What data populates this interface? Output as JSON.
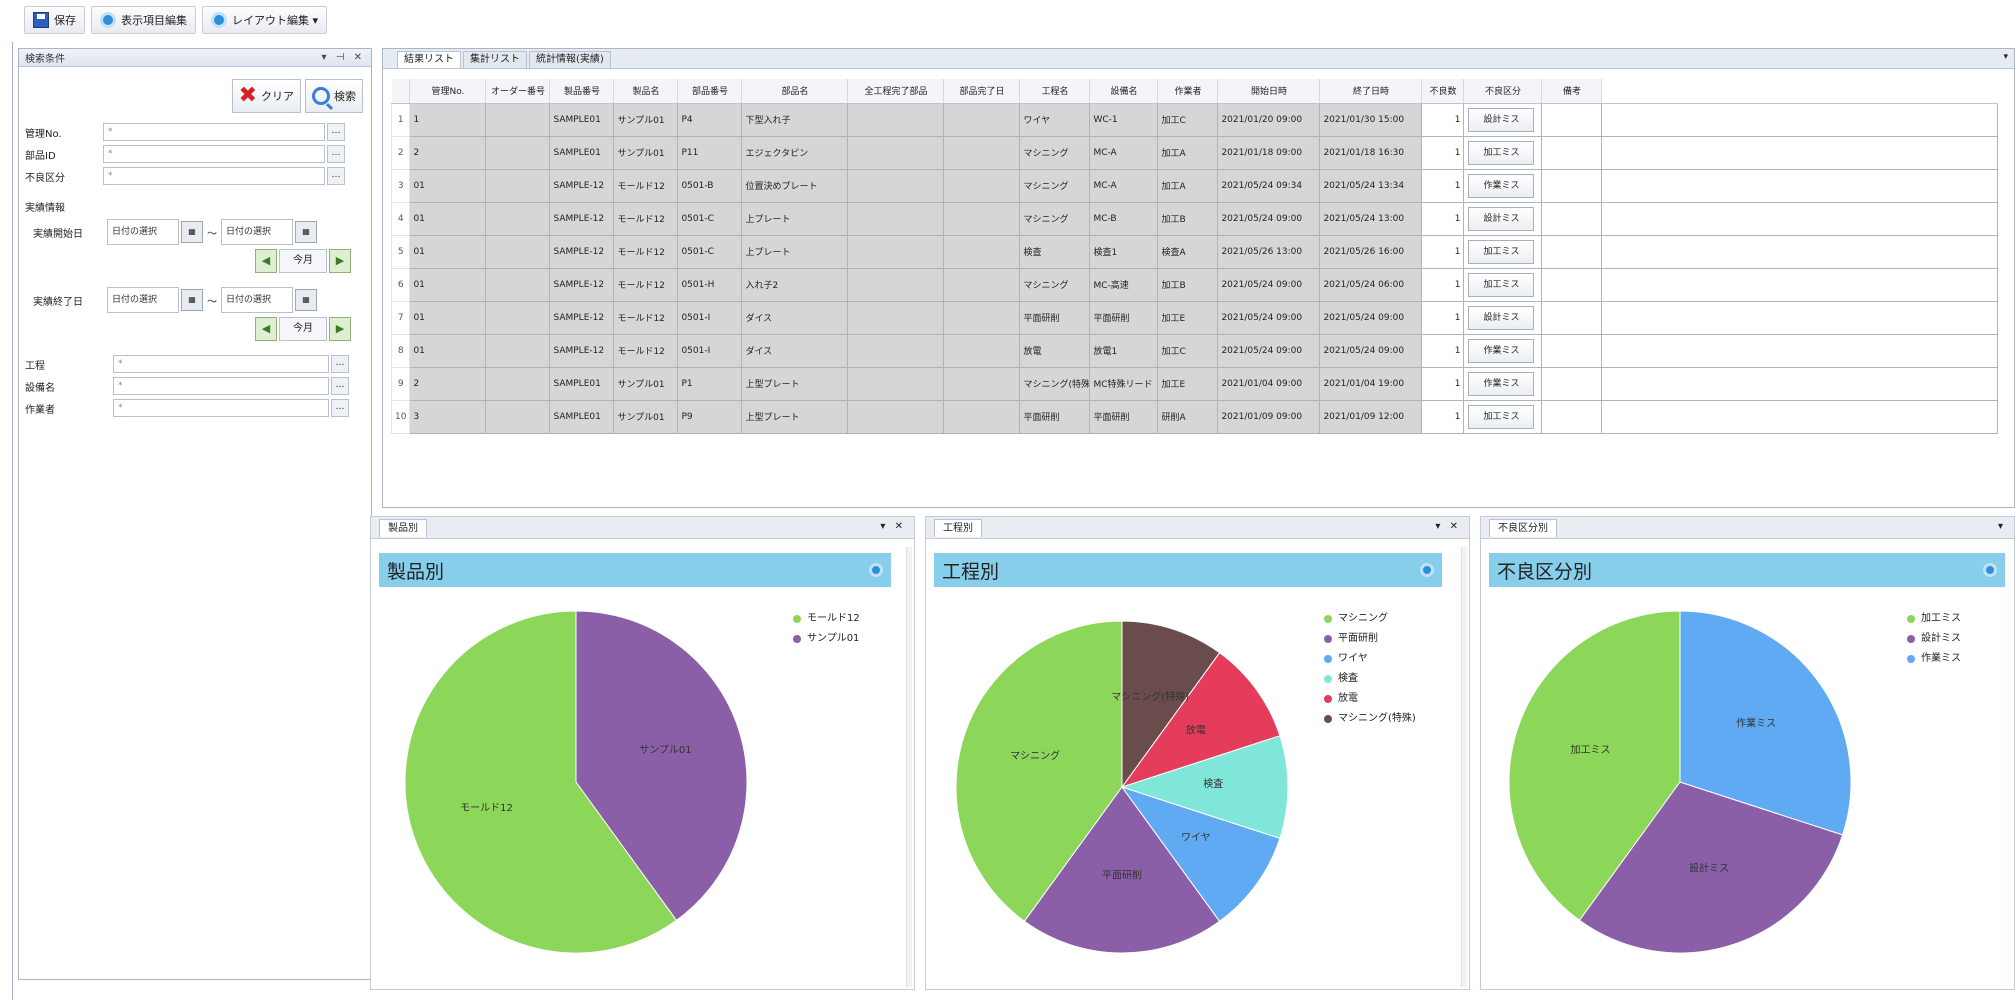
{
  "toolbar": {
    "save": "保存",
    "display_items": "表示項目編集",
    "layout": "レイアウト編集 ▾"
  },
  "left_panel": {
    "title": "検索条件",
    "controls": "▾ ⊣ ✕",
    "clear": "クリア",
    "search": "検索",
    "fields": [
      {
        "label": "管理No.",
        "value": "*"
      },
      {
        "label": "部品ID",
        "value": "*"
      },
      {
        "label": "不良区分",
        "value": "*"
      }
    ],
    "period_label": "実績情報",
    "start_label": "実績開始日",
    "end_label": "実績終了日",
    "date_from": "日付の選択",
    "date_to": "日付の選択",
    "range_sep": "～",
    "today": "今月",
    "prev": "◀",
    "next": "▶",
    "fields2": [
      {
        "label": "工程",
        "value": "*"
      },
      {
        "label": "設備名",
        "value": "*"
      },
      {
        "label": "作業者",
        "value": "*"
      }
    ]
  },
  "grid": {
    "tabs": [
      "結果リスト",
      "集計リスト",
      "統計情報(実績)"
    ],
    "columns": [
      "管理No.",
      "オーダー番号",
      "製品番号",
      "製品名",
      "部品番号",
      "部品名",
      "全工程完了部品",
      "部品完了日",
      "工程名",
      "設備名",
      "作業者",
      "開始日時",
      "終了日時",
      "不良数",
      "不良区分",
      "備考"
    ],
    "rows": [
      [
        "1",
        "",
        "SAMPLE01",
        "サンプル01",
        "P4",
        "下型入れ子",
        "",
        "",
        "ワイヤ",
        "WC-1",
        "加工C",
        "2021/01/20 09:00",
        "2021/01/30 15:00",
        "1",
        "設計ミス",
        ""
      ],
      [
        "2",
        "",
        "SAMPLE01",
        "サンプル01",
        "P11",
        "エジェクタピン",
        "",
        "",
        "マシニング",
        "MC-A",
        "加工A",
        "2021/01/18 09:00",
        "2021/01/18 16:30",
        "1",
        "加工ミス",
        ""
      ],
      [
        "01",
        "",
        "SAMPLE-12",
        "モールド12",
        "0501-B",
        "位置決めプレート",
        "",
        "",
        "マシニング",
        "MC-A",
        "加工A",
        "2021/05/24 09:34",
        "2021/05/24 13:34",
        "1",
        "作業ミス",
        ""
      ],
      [
        "01",
        "",
        "SAMPLE-12",
        "モールド12",
        "0501-C",
        "上プレート",
        "",
        "",
        "マシニング",
        "MC-B",
        "加工B",
        "2021/05/24 09:00",
        "2021/05/24 13:00",
        "1",
        "設計ミス",
        ""
      ],
      [
        "01",
        "",
        "SAMPLE-12",
        "モールド12",
        "0501-C",
        "上プレート",
        "",
        "",
        "検査",
        "検査1",
        "検査A",
        "2021/05/26 13:00",
        "2021/05/26 16:00",
        "1",
        "加工ミス",
        ""
      ],
      [
        "01",
        "",
        "SAMPLE-12",
        "モールド12",
        "0501-H",
        "入れ子2",
        "",
        "",
        "マシニング",
        "MC-高速",
        "加工B",
        "2021/05/24 09:00",
        "2021/05/24 06:00",
        "1",
        "加工ミス",
        ""
      ],
      [
        "01",
        "",
        "SAMPLE-12",
        "モールド12",
        "0501-I",
        "ダイス",
        "",
        "",
        "平面研削",
        "平面研削",
        "加工E",
        "2021/05/24 09:00",
        "2021/05/24 09:00",
        "1",
        "設計ミス",
        ""
      ],
      [
        "01",
        "",
        "SAMPLE-12",
        "モールド12",
        "0501-I",
        "ダイス",
        "",
        "",
        "放電",
        "放電1",
        "加工C",
        "2021/05/24 09:00",
        "2021/05/24 09:00",
        "1",
        "作業ミス",
        ""
      ],
      [
        "2",
        "",
        "SAMPLE01",
        "サンプル01",
        "P1",
        "上型プレート",
        "",
        "",
        "マシニング(特殊)",
        "MC特殊リード",
        "加工E",
        "2021/01/04 09:00",
        "2021/01/04 19:00",
        "1",
        "作業ミス",
        ""
      ],
      [
        "3",
        "",
        "SAMPLE01",
        "サンプル01",
        "P9",
        "上型プレート",
        "",
        "",
        "平面研削",
        "平面研削",
        "研削A",
        "2021/01/09 09:00",
        "2021/01/09 12:00",
        "1",
        "加工ミス",
        ""
      ]
    ]
  },
  "charts": [
    {
      "tab": "製品別",
      "title": "製品別",
      "controls": "▾ ✕"
    },
    {
      "tab": "工程別",
      "title": "工程別",
      "controls": "▾ ✕"
    },
    {
      "tab": "不良区分別",
      "title": "不良区分別",
      "controls": "▾"
    }
  ],
  "chart_data": [
    {
      "type": "pie",
      "title": "製品別",
      "slices": [
        {
          "label": "モールド12",
          "value": 6,
          "color": "#8cd65a"
        },
        {
          "label": "サンプル01",
          "value": 4,
          "color": "#8a5fa8"
        }
      ]
    },
    {
      "type": "pie",
      "title": "工程別",
      "slices": [
        {
          "label": "マシニング",
          "value": 4,
          "color": "#8cd65a"
        },
        {
          "label": "平面研削",
          "value": 2,
          "color": "#8a5fa8"
        },
        {
          "label": "ワイヤ",
          "value": 1,
          "color": "#60aaf4"
        },
        {
          "label": "検査",
          "value": 1,
          "color": "#7fe6d9"
        },
        {
          "label": "放電",
          "value": 1,
          "color": "#e43c5a"
        },
        {
          "label": "マシニング(特殊)",
          "value": 1,
          "color": "#6b4c4c"
        }
      ]
    },
    {
      "type": "pie",
      "title": "不良区分別",
      "slices": [
        {
          "label": "加工ミス",
          "value": 4,
          "color": "#8cd65a"
        },
        {
          "label": "設計ミス",
          "value": 3,
          "color": "#8a5fa8"
        },
        {
          "label": "作業ミス",
          "value": 3,
          "color": "#60aaf4"
        }
      ]
    }
  ]
}
